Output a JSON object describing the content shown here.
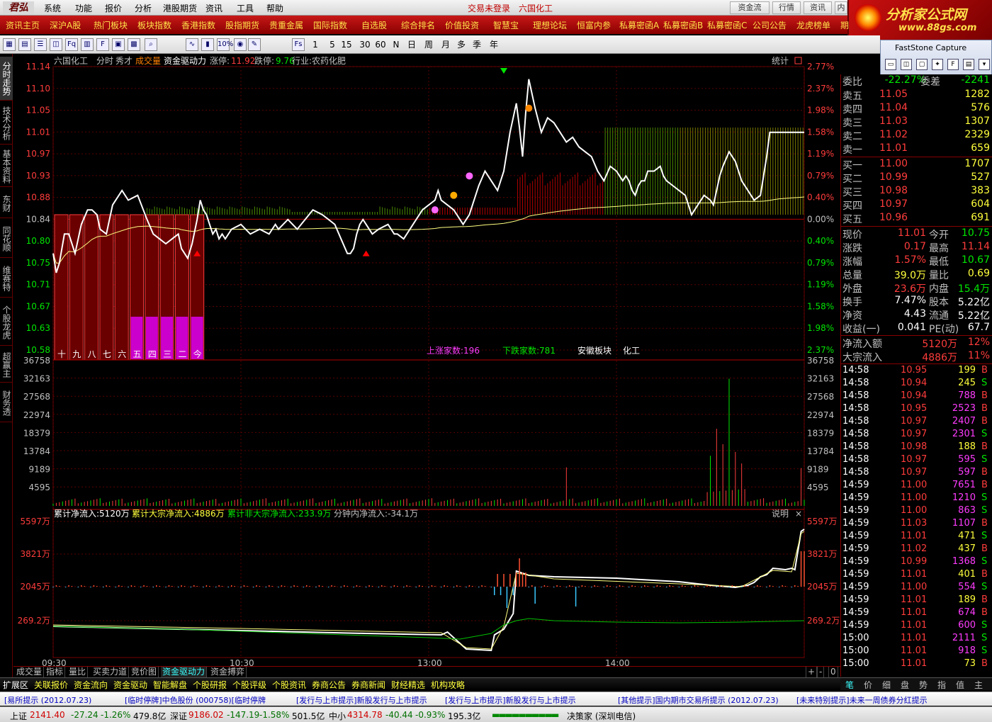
{
  "menubar": {
    "logo": "君弘",
    "items": [
      "系统",
      "功能",
      "报价",
      "分析",
      "港股期货",
      "资讯",
      "工具",
      "帮助"
    ],
    "status": "交易未登录",
    "stock": "六国化工"
  },
  "topright_tabs": [
    "资金流",
    "行情",
    "资讯",
    "内"
  ],
  "brand": {
    "line1": "分析家公式网",
    "line2": "www.88gs.com"
  },
  "navbar": [
    "资讯主页",
    "深沪A股",
    "热门板块",
    "板块指数",
    "香港指数",
    "股指期货",
    "贵重金属",
    "国际指数",
    "自选股",
    "综合排名",
    "价值投资",
    "智慧宝",
    "理想论坛",
    "恒富内参",
    "私募密函A",
    "私募密函B",
    "私募密函C",
    "公司公告",
    "龙虎榜单",
    "期",
    "龙虎"
  ],
  "toolbar": {
    "periods": [
      "1",
      "5",
      "15",
      "30",
      "60",
      "N",
      "日",
      "周",
      "月",
      "多",
      "季",
      "年"
    ],
    "fs_label": "Fs",
    "pct_label": "10%"
  },
  "faststone": {
    "title": "FastStone Capture"
  },
  "leftbar": [
    "分时走势",
    "技术分析",
    "基本资料",
    "东财10",
    "同花顺10",
    "维赛特10",
    "个股龙虎榜",
    "超赢主力",
    "财务透视"
  ],
  "header": {
    "name": "六国化工",
    "mode": "分时",
    "xiucai": "秀才",
    "cjl": "成交量",
    "zjqd": "资金驱动力",
    "zt_label": "涨停:",
    "zt": "11.92",
    "dt_label": "跌停:",
    "dt": "9.76",
    "industry": "行业:农药化肥",
    "stat": "统计"
  },
  "price_axis": {
    "left": [
      "11.14",
      "11.10",
      "11.05",
      "11.01",
      "10.97",
      "10.93",
      "10.88",
      "10.84",
      "10.80",
      "10.75",
      "10.71",
      "10.67",
      "10.63",
      "10.58"
    ],
    "right": [
      "2.77%",
      "2.37%",
      "1.98%",
      "1.58%",
      "1.19%",
      "0.79%",
      "0.40%",
      "0.00%",
      "0.40%",
      "0.79%",
      "1.19%",
      "1.58%",
      "1.98%",
      "2.37%"
    ]
  },
  "days": [
    "十",
    "九",
    "八",
    "七",
    "六",
    "五",
    "四",
    "三",
    "二",
    "今"
  ],
  "breadth": {
    "up": "上涨家数:196",
    "down": "下跌家数:781",
    "sector": "安徽板块",
    "industry": "化工"
  },
  "vol_axis": [
    "36758",
    "32163",
    "27568",
    "22974",
    "18379",
    "13784",
    "9189",
    "4595"
  ],
  "flow_header": {
    "cum": "累计净流入:5120万",
    "big": "累计大宗净流入:4886万",
    "nonbig": "累计非大宗净流入:233.9万",
    "minute": "分钟内净流入:-34.1万",
    "desc": "说明"
  },
  "flow_axis": [
    "5597万",
    "3821万",
    "2045万",
    "269.2万"
  ],
  "time_axis": [
    "09:30",
    "10:30",
    "13:00",
    "14:00"
  ],
  "right_panel": {
    "weibi": {
      "l1": "委比",
      "v1": "-22.27%",
      "l2": "委差",
      "v2": "-2241"
    },
    "asks": [
      {
        "l": "卖五",
        "p": "11.05",
        "v": "1282"
      },
      {
        "l": "卖四",
        "p": "11.04",
        "v": "576"
      },
      {
        "l": "卖三",
        "p": "11.03",
        "v": "1307"
      },
      {
        "l": "卖二",
        "p": "11.02",
        "v": "2329"
      },
      {
        "l": "卖一",
        "p": "11.01",
        "v": "659"
      }
    ],
    "bids": [
      {
        "l": "买一",
        "p": "11.00",
        "v": "1707"
      },
      {
        "l": "买二",
        "p": "10.99",
        "v": "527"
      },
      {
        "l": "买三",
        "p": "10.98",
        "v": "383"
      },
      {
        "l": "买四",
        "p": "10.97",
        "v": "604"
      },
      {
        "l": "买五",
        "p": "10.96",
        "v": "691"
      }
    ],
    "quote": [
      {
        "l1": "现价",
        "v1": "11.01",
        "c1": "up",
        "l2": "今开",
        "v2": "10.75",
        "c2": "dn"
      },
      {
        "l1": "涨跌",
        "v1": "0.17",
        "c1": "up",
        "l2": "最高",
        "v2": "11.14",
        "c2": "up"
      },
      {
        "l1": "涨幅",
        "v1": "1.57%",
        "c1": "up",
        "l2": "最低",
        "v2": "10.67",
        "c2": "dn"
      },
      {
        "l1": "总量",
        "v1": "39.0万",
        "c1": "yl",
        "l2": "量比",
        "v2": "0.69",
        "c2": "yl"
      },
      {
        "l1": "外盘",
        "v1": "23.6万",
        "c1": "up",
        "l2": "内盘",
        "v2": "15.4万",
        "c2": "dn"
      },
      {
        "l1": "换手",
        "v1": "7.47%",
        "c1": "wh",
        "l2": "股本",
        "v2": "5.22亿",
        "c2": "wh"
      },
      {
        "l1": "净资",
        "v1": "4.43",
        "c1": "wh",
        "l2": "流通",
        "v2": "5.22亿",
        "c2": "wh"
      },
      {
        "l1": "收益(一)",
        "v1": "0.041",
        "c1": "wh",
        "l2": "PE(动)",
        "v2": "67.7",
        "c2": "wh"
      }
    ],
    "netflow": {
      "l": "净流入额",
      "v": "5120万",
      "p": "12%"
    },
    "bigflow": {
      "l": "大宗流入",
      "v": "4886万",
      "p": "11%"
    },
    "ticks": [
      {
        "t": "14:58",
        "p": "10.95",
        "v": "199",
        "s": "B"
      },
      {
        "t": "14:58",
        "p": "10.94",
        "v": "245",
        "s": "S"
      },
      {
        "t": "14:58",
        "p": "10.94",
        "v": "788",
        "s": "B"
      },
      {
        "t": "14:58",
        "p": "10.95",
        "v": "2523",
        "s": "B"
      },
      {
        "t": "14:58",
        "p": "10.97",
        "v": "2407",
        "s": "B"
      },
      {
        "t": "14:58",
        "p": "10.97",
        "v": "2301",
        "s": "S"
      },
      {
        "t": "14:58",
        "p": "10.98",
        "v": "188",
        "s": "B"
      },
      {
        "t": "14:58",
        "p": "10.97",
        "v": "595",
        "s": "S"
      },
      {
        "t": "14:58",
        "p": "10.97",
        "v": "597",
        "s": "B"
      },
      {
        "t": "14:59",
        "p": "11.00",
        "v": "7651",
        "s": "B"
      },
      {
        "t": "14:59",
        "p": "11.00",
        "v": "1210",
        "s": "S"
      },
      {
        "t": "14:59",
        "p": "11.00",
        "v": "863",
        "s": "S"
      },
      {
        "t": "14:59",
        "p": "11.03",
        "v": "1107",
        "s": "B"
      },
      {
        "t": "14:59",
        "p": "11.01",
        "v": "471",
        "s": "S"
      },
      {
        "t": "14:59",
        "p": "11.02",
        "v": "437",
        "s": "B"
      },
      {
        "t": "14:59",
        "p": "10.99",
        "v": "1368",
        "s": "S"
      },
      {
        "t": "14:59",
        "p": "11.01",
        "v": "401",
        "s": "B"
      },
      {
        "t": "14:59",
        "p": "11.00",
        "v": "554",
        "s": "S"
      },
      {
        "t": "14:59",
        "p": "11.01",
        "v": "189",
        "s": "B"
      },
      {
        "t": "14:59",
        "p": "11.01",
        "v": "674",
        "s": "B"
      },
      {
        "t": "14:59",
        "p": "11.01",
        "v": "600",
        "s": "S"
      },
      {
        "t": "15:00",
        "p": "11.01",
        "v": "2111",
        "s": "S"
      },
      {
        "t": "15:00",
        "p": "11.01",
        "v": "918",
        "s": "S"
      },
      {
        "t": "15:00",
        "p": "11.01",
        "v": "73",
        "s": "B"
      }
    ]
  },
  "bottom_tabs": [
    "成交量",
    "指标",
    "量比",
    "买卖力道",
    "竞价图",
    "资金驱动力",
    "资金搏弈"
  ],
  "bottom_ctrl": [
    "+",
    "-",
    "0"
  ],
  "extbar": [
    "扩展区",
    "关联报价",
    "资金流向",
    "资金驱动",
    "智能解盘",
    "个股研报",
    "个股评级",
    "个股资讯",
    "券商公告",
    "券商新闻",
    "财经精选",
    "机构攻略"
  ],
  "right_tabs": [
    "笔",
    "价",
    "细",
    "盘",
    "势",
    "指",
    "值",
    "主"
  ],
  "news": [
    "[易所提示 (2012.07.23)",
    "[临时停牌]中色股份 (000758)[临时停牌",
    "[发行与上市提示]新股发行与上市提示",
    "[发行与上市提示]新股发行与上市提示",
    "[其他提示]国内期市交易所提示 (2012.07.23)",
    "[未来特别提示]未来一周债券分红提示"
  ],
  "status": {
    "sh_label": "上证",
    "sh": "2141.40",
    "sh_chg": "-27.24",
    "sh_pct": "-1.26%",
    "sh_amt": "479.8亿",
    "sz_label": "深证",
    "sz": "9186.02",
    "sz_chg": "-147.19",
    "sz_pct": "-1.58%",
    "sz_amt": "501.5亿",
    "zx_label": "中小",
    "zx": "4314.78",
    "zx_chg": "-40.44",
    "zx_pct": "-0.93%",
    "zx_amt": "195.3亿",
    "app": "决策家 (深圳电信)"
  },
  "colors": {
    "up": "#ff3c3c",
    "down": "#00e600",
    "price_line": "#ffffff",
    "avg_line": "#ffff80",
    "grid": "#7a0000",
    "nav_bg": "#b01010",
    "nav_text": "#ffe14a"
  },
  "chart_data": {
    "type": "line",
    "price": {
      "prev_close": 10.84,
      "ylim": [
        10.54,
        11.14
      ],
      "x_minutes": [
        0,
        5,
        10,
        18,
        25,
        35,
        45,
        55,
        62,
        70,
        75,
        85,
        95,
        110,
        120,
        135,
        150,
        160,
        170,
        180,
        190,
        200,
        205,
        215,
        222,
        230,
        235,
        240,
        245,
        250,
        255,
        260,
        265,
        270,
        275,
        285,
        300,
        315,
        330,
        345,
        355,
        360,
        375,
        390,
        415,
        430,
        440,
        450,
        460,
        470,
        475,
        480,
        485,
        490,
        495,
        500,
        510,
        520,
        535,
        540,
        545,
        550,
        560,
        575,
        590,
        600,
        610,
        615,
        620,
        630,
        640,
        645,
        650,
        655,
        660,
        665,
        670,
        680,
        690,
        700,
        710,
        720,
        730,
        740,
        745,
        750,
        755,
        760,
        770,
        780,
        790,
        800,
        810,
        820,
        830,
        840,
        850,
        860,
        870,
        880,
        890,
        900,
        905,
        910,
        915,
        920,
        925,
        930,
        935,
        940,
        945,
        950,
        960,
        970,
        975,
        980,
        990,
        1000,
        1010,
        1020,
        1030,
        1040,
        1050,
        1055,
        1060,
        1065,
        1070,
        1080,
        1090,
        1100,
        1110,
        1120,
        1130,
        1135,
        1140,
        1145,
        1150,
        1155,
        1160,
        1170,
        1180,
        1190,
        1200
      ],
      "values": [
        10.76,
        10.72,
        10.74,
        10.8,
        10.8,
        10.76,
        10.82,
        10.85,
        10.85,
        10.84,
        10.81,
        10.8,
        10.86,
        10.89,
        10.87,
        10.88,
        10.83,
        10.8,
        10.79,
        10.78,
        10.79,
        10.8,
        10.77,
        10.75,
        10.78,
        10.83,
        10.87,
        10.85,
        10.84,
        10.82,
        10.8,
        10.81,
        10.79,
        10.8,
        10.79,
        10.81,
        10.82,
        10.8,
        10.81,
        10.8,
        10.82,
        10.81,
        10.83,
        10.81,
        10.85,
        10.84,
        10.83,
        10.82,
        10.79,
        10.76,
        10.76,
        10.77,
        10.8,
        10.82,
        10.83,
        10.82,
        10.8,
        10.81,
        10.82,
        10.81,
        10.8,
        10.8,
        10.79,
        10.82,
        10.85,
        10.86,
        10.87,
        10.89,
        10.87,
        10.86,
        10.85,
        10.84,
        10.83,
        10.82,
        10.83,
        10.84,
        10.86,
        10.9,
        10.93,
        10.91,
        10.89,
        10.93,
        11.01,
        11.07,
        11.02,
        10.96,
        11.05,
        11.12,
        11.06,
        11.01,
        11.04,
        11.03,
        11.01,
        10.99,
        11.0,
        10.98,
        10.97,
        10.96,
        10.93,
        10.91,
        10.94,
        10.93,
        10.92,
        10.91,
        10.92,
        10.91,
        10.89,
        10.88,
        10.9,
        10.91,
        10.91,
        10.93,
        10.93,
        10.94,
        10.92,
        10.91,
        10.9,
        10.89,
        10.88,
        10.84,
        10.86,
        10.88,
        10.87,
        10.86,
        10.89,
        10.92,
        10.94,
        10.97,
        10.95,
        10.91,
        10.89,
        10.87,
        10.88,
        10.92,
        10.96,
        11.01,
        11.01,
        11.01,
        11.01,
        11.01,
        11.01,
        11.01,
        11.01
      ]
    },
    "volume": {
      "ylim": [
        0,
        36758
      ],
      "spikes": [
        {
          "x": 820,
          "v": 10000
        },
        {
          "x": 1050,
          "v": 13000
        },
        {
          "x": 1060,
          "v": 20000
        },
        {
          "x": 1070,
          "v": 16000
        },
        {
          "x": 1080,
          "v": 33000
        },
        {
          "x": 1090,
          "v": 14000
        },
        {
          "x": 1100,
          "v": 11000
        },
        {
          "x": 1195,
          "v": 9800
        }
      ]
    },
    "flow": {
      "ylim": [
        0,
        5597
      ],
      "ticks": [
        "5597万",
        "3821万",
        "2045万",
        "269.2万"
      ]
    }
  }
}
